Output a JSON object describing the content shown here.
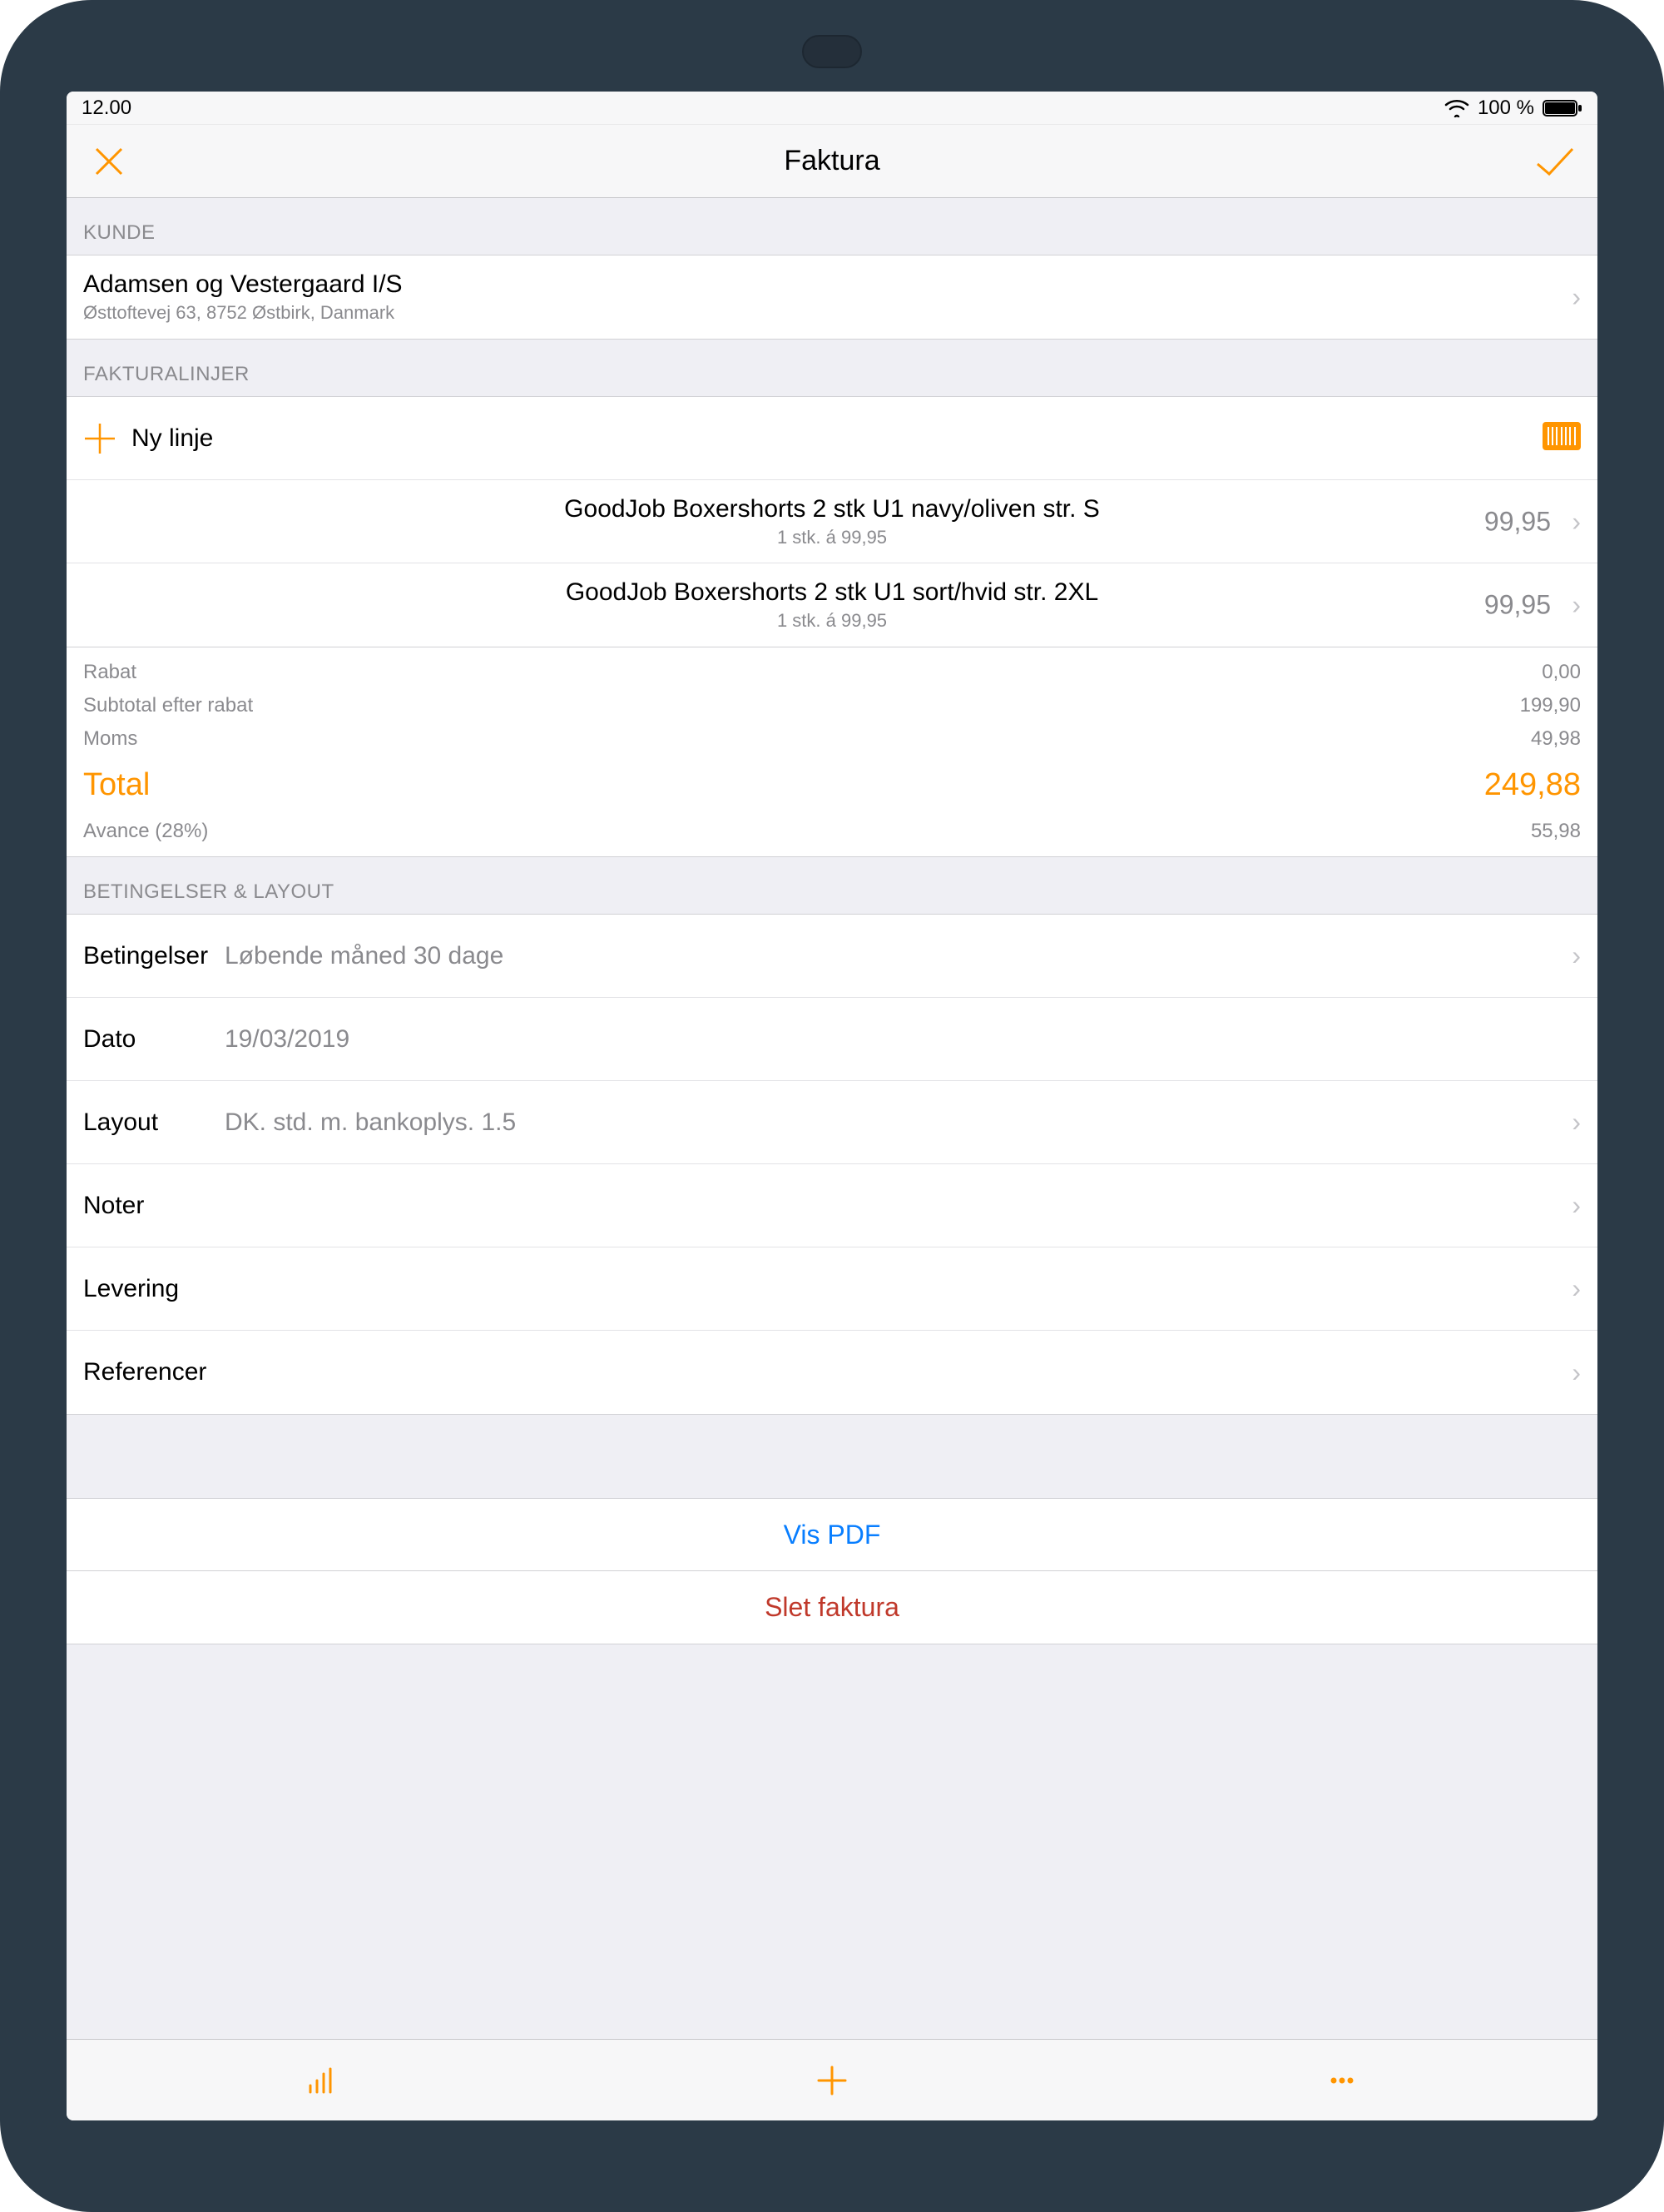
{
  "statusbar": {
    "time": "12.00",
    "battery": "100 %"
  },
  "navbar": {
    "title": "Faktura"
  },
  "sections": {
    "customer_header": "KUNDE",
    "lines_header": "FAKTURALINJER",
    "terms_header": "BETINGELSER & LAYOUT"
  },
  "customer": {
    "name": "Adamsen og Vestergaard I/S",
    "address": "Østtoftevej 63, 8752 Østbirk, Danmark"
  },
  "newline_label": "Ny linje",
  "lines": [
    {
      "name": "GoodJob  Boxershorts 2 stk U1 navy/oliven str. S",
      "sub": "1 stk. á 99,95",
      "price": "99,95"
    },
    {
      "name": "GoodJob  Boxershorts 2 stk U1 sort/hvid str. 2XL",
      "sub": "1 stk. á 99,95",
      "price": "99,95"
    }
  ],
  "totals": {
    "rabat_label": "Rabat",
    "rabat_value": "0,00",
    "subtotal_label": "Subtotal efter rabat",
    "subtotal_value": "199,90",
    "moms_label": "Moms",
    "moms_value": "49,98",
    "total_label": "Total",
    "total_value": "249,88",
    "avance_label": "Avance (28%)",
    "avance_value": "55,98"
  },
  "terms": {
    "betingelser_label": "Betingelser",
    "betingelser_value": "Løbende måned 30 dage",
    "dato_label": "Dato",
    "dato_value": "19/03/2019",
    "layout_label": "Layout",
    "layout_value": "DK. std. m. bankoplys. 1.5",
    "noter_label": "Noter",
    "levering_label": "Levering",
    "referencer_label": "Referencer"
  },
  "actions": {
    "view_pdf": "Vis PDF",
    "delete": "Slet faktura"
  }
}
